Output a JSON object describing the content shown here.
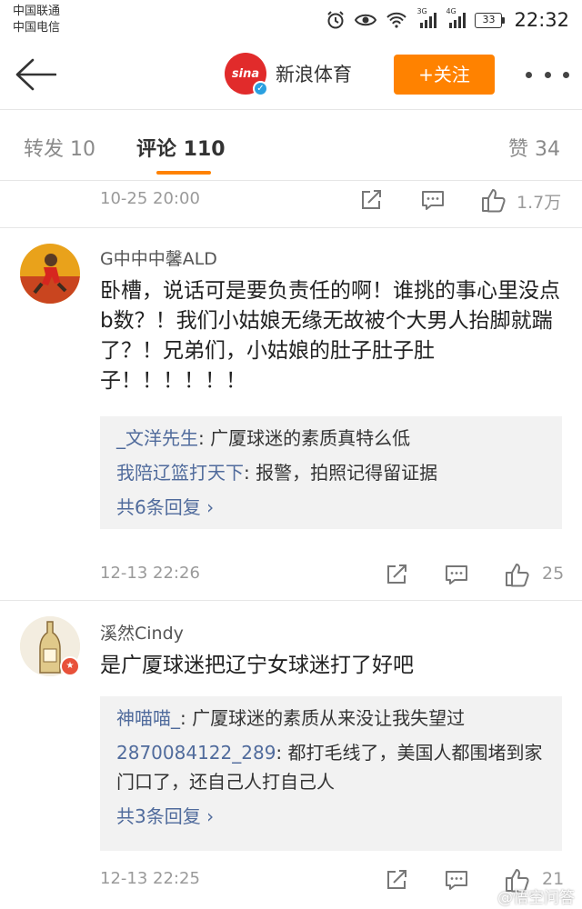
{
  "status_bar": {
    "carrier1": "中国联通",
    "carrier2": "中国电信",
    "net1": "3G",
    "net2": "4G",
    "battery": "33",
    "time": "22:32"
  },
  "header": {
    "logo_text": "sina",
    "account_name": "新浪体育",
    "follow_label": "+关注"
  },
  "tabs": {
    "repost": "转发 10",
    "comments": "评论 110",
    "likes": "赞 34"
  },
  "post_actions": {
    "time": "10-25 20:00",
    "like_count": "1.7万"
  },
  "comments": [
    {
      "username": "G中中中馨ALD",
      "text": "卧槽，说话可是要负责任的啊！谁挑的事心里没点b数？！我们小姑娘无缘无故被个大男人抬脚就踹了？！兄弟们，小姑娘的肚子肚子肚子！！！！！！",
      "replies": [
        {
          "user": "_文洋先生",
          "text": ": 广厦球迷的素质真特么低"
        },
        {
          "user": "我陪辽篮打天下",
          "text": ": 报警，拍照记得留证据"
        }
      ],
      "more_label": "共6条回复 ",
      "time": "12-13 22:26",
      "like_count": "25"
    },
    {
      "username": "溪然Cindy",
      "text": "是广厦球迷把辽宁女球迷打了好吧",
      "replies": [
        {
          "user": "神喵喵_",
          "text": ": 广厦球迷的素质从来没让我失望过"
        },
        {
          "user": "2870084122_289",
          "text": ": 都打毛线了，美国人都围堵到家门口了，还自己人打自己人"
        }
      ],
      "more_label": "共3条回复 ",
      "time": "12-13 22:25",
      "like_count": "21"
    }
  ],
  "watermark": "@悟空问答",
  "colors": {
    "accent": "#ff8200",
    "link": "#506b9c",
    "sina_red": "#e12b2b"
  }
}
